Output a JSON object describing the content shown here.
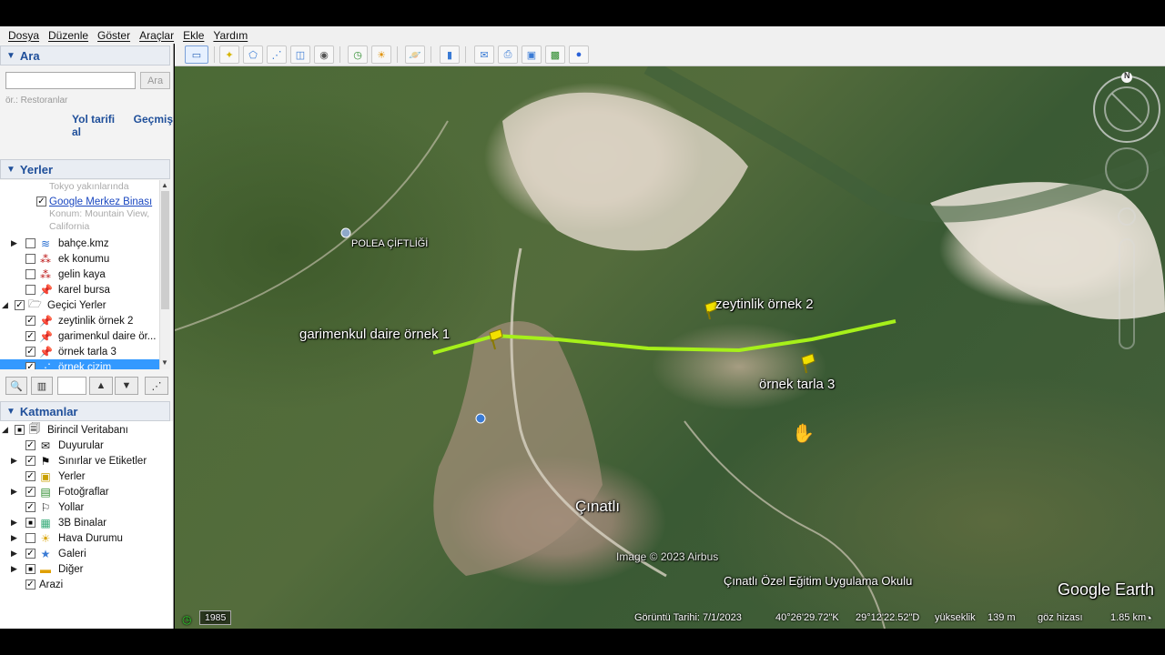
{
  "menu": [
    "Dosya",
    "Düzenle",
    "Göster",
    "Araçlar",
    "Ekle",
    "Yardım"
  ],
  "search": {
    "title": "Ara",
    "button": "Ara",
    "hint": "ör.: Restoranlar",
    "directions_link": "Yol tarifi al",
    "history_link": "Geçmiş"
  },
  "places": {
    "title": "Yerler",
    "items": [
      {
        "label": "Tokyo yakınlarında",
        "kind": "sub"
      },
      {
        "label": "Google Merkez Binası",
        "checked": true,
        "icon": "pin-icon"
      },
      {
        "label": "Konum: Mountain View,",
        "kind": "sub"
      },
      {
        "label": "California",
        "kind": "sub"
      },
      {
        "label": "bahçe.kmz",
        "checked": false,
        "icon": "kmz-icon"
      },
      {
        "label": "ek konumu",
        "checked": false,
        "icon": "placemarks-icon"
      },
      {
        "label": "gelin kaya",
        "checked": false,
        "icon": "placemarks-icon"
      },
      {
        "label": "karel bursa",
        "checked": false,
        "icon": "pin-icon"
      },
      {
        "label": "Geçici Yerler",
        "checked": true,
        "icon": "folder-icon"
      },
      {
        "label": "zeytinlik örnek 2",
        "checked": true,
        "icon": "pin-icon"
      },
      {
        "label": "garimenkul daire ör...",
        "checked": true,
        "icon": "pin-icon"
      },
      {
        "label": "örnek tarla 3",
        "checked": true,
        "icon": "pin-icon"
      },
      {
        "label": "örnek çizim",
        "checked": true,
        "icon": "path-icon",
        "selected": true
      }
    ]
  },
  "layers": {
    "title": "Katmanlar",
    "items": [
      {
        "label": "Birincil Veritabanı"
      },
      {
        "label": "Duyurular"
      },
      {
        "label": "Sınırlar ve Etiketler"
      },
      {
        "label": "Yerler"
      },
      {
        "label": "Fotoğraflar"
      },
      {
        "label": "Yollar"
      },
      {
        "label": "3B Binalar"
      },
      {
        "label": "Hava Durumu"
      },
      {
        "label": "Galeri"
      },
      {
        "label": "Diğer"
      },
      {
        "label": "Arazi"
      }
    ]
  },
  "map": {
    "labels": {
      "place_farm": "POLEA ÇİFTLİĞİ",
      "pin1": "garimenkul daire örnek 1",
      "pin2": "zeytinlik örnek 2",
      "pin3": "örnek tarla 3",
      "town": "Çınatlı",
      "school": "Çınatlı Özel Eğitim Uygulama Okulu",
      "imagery": "Image © 2023 Airbus",
      "brand": "Google Earth",
      "compass": "N"
    },
    "path_color": "#a6f01a"
  },
  "status": {
    "year": "1985",
    "date": "Görüntü Tarihi: 7/1/2023",
    "lat": "40°26'29.72\"K",
    "lon": "29°12'22.52\"D",
    "elev_label": "yükseklik",
    "elev": "139 m",
    "eye_label": "göz hizası",
    "eye": "1.85 km"
  }
}
